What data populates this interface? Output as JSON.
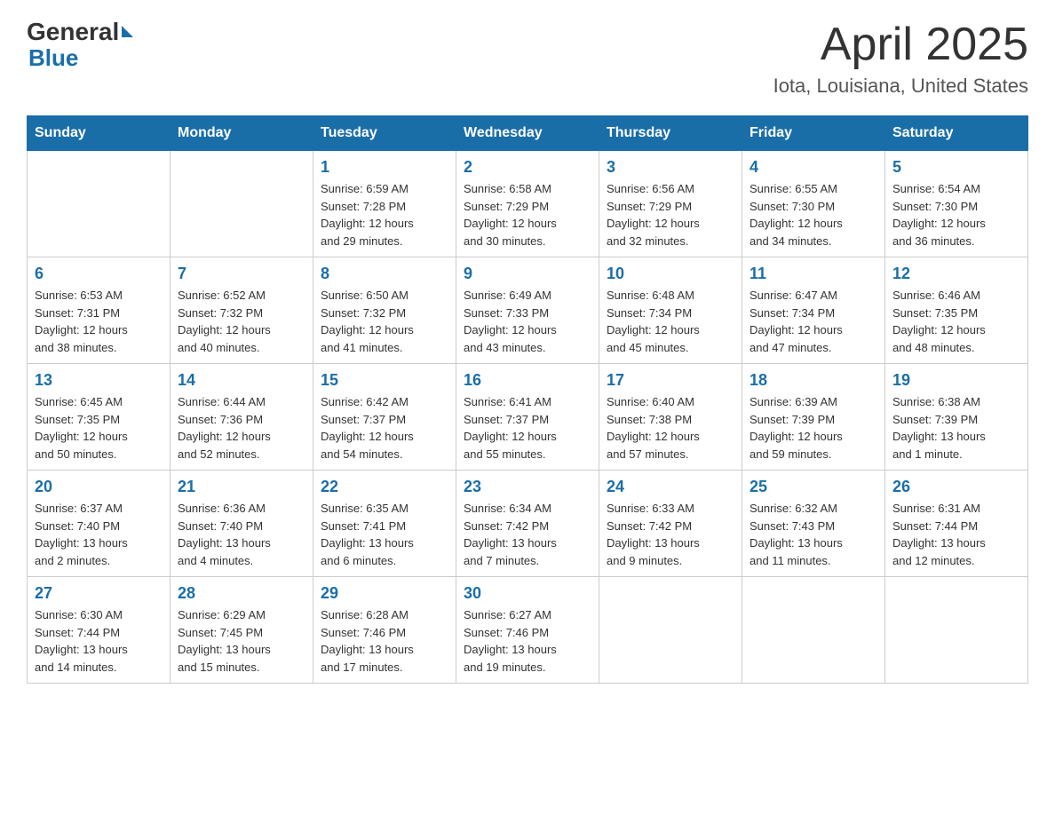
{
  "header": {
    "logo_general": "General",
    "logo_blue": "Blue",
    "month": "April 2025",
    "location": "Iota, Louisiana, United States"
  },
  "days_of_week": [
    "Sunday",
    "Monday",
    "Tuesday",
    "Wednesday",
    "Thursday",
    "Friday",
    "Saturday"
  ],
  "weeks": [
    [
      {
        "day": "",
        "info": ""
      },
      {
        "day": "",
        "info": ""
      },
      {
        "day": "1",
        "info": "Sunrise: 6:59 AM\nSunset: 7:28 PM\nDaylight: 12 hours\nand 29 minutes."
      },
      {
        "day": "2",
        "info": "Sunrise: 6:58 AM\nSunset: 7:29 PM\nDaylight: 12 hours\nand 30 minutes."
      },
      {
        "day": "3",
        "info": "Sunrise: 6:56 AM\nSunset: 7:29 PM\nDaylight: 12 hours\nand 32 minutes."
      },
      {
        "day": "4",
        "info": "Sunrise: 6:55 AM\nSunset: 7:30 PM\nDaylight: 12 hours\nand 34 minutes."
      },
      {
        "day": "5",
        "info": "Sunrise: 6:54 AM\nSunset: 7:30 PM\nDaylight: 12 hours\nand 36 minutes."
      }
    ],
    [
      {
        "day": "6",
        "info": "Sunrise: 6:53 AM\nSunset: 7:31 PM\nDaylight: 12 hours\nand 38 minutes."
      },
      {
        "day": "7",
        "info": "Sunrise: 6:52 AM\nSunset: 7:32 PM\nDaylight: 12 hours\nand 40 minutes."
      },
      {
        "day": "8",
        "info": "Sunrise: 6:50 AM\nSunset: 7:32 PM\nDaylight: 12 hours\nand 41 minutes."
      },
      {
        "day": "9",
        "info": "Sunrise: 6:49 AM\nSunset: 7:33 PM\nDaylight: 12 hours\nand 43 minutes."
      },
      {
        "day": "10",
        "info": "Sunrise: 6:48 AM\nSunset: 7:34 PM\nDaylight: 12 hours\nand 45 minutes."
      },
      {
        "day": "11",
        "info": "Sunrise: 6:47 AM\nSunset: 7:34 PM\nDaylight: 12 hours\nand 47 minutes."
      },
      {
        "day": "12",
        "info": "Sunrise: 6:46 AM\nSunset: 7:35 PM\nDaylight: 12 hours\nand 48 minutes."
      }
    ],
    [
      {
        "day": "13",
        "info": "Sunrise: 6:45 AM\nSunset: 7:35 PM\nDaylight: 12 hours\nand 50 minutes."
      },
      {
        "day": "14",
        "info": "Sunrise: 6:44 AM\nSunset: 7:36 PM\nDaylight: 12 hours\nand 52 minutes."
      },
      {
        "day": "15",
        "info": "Sunrise: 6:42 AM\nSunset: 7:37 PM\nDaylight: 12 hours\nand 54 minutes."
      },
      {
        "day": "16",
        "info": "Sunrise: 6:41 AM\nSunset: 7:37 PM\nDaylight: 12 hours\nand 55 minutes."
      },
      {
        "day": "17",
        "info": "Sunrise: 6:40 AM\nSunset: 7:38 PM\nDaylight: 12 hours\nand 57 minutes."
      },
      {
        "day": "18",
        "info": "Sunrise: 6:39 AM\nSunset: 7:39 PM\nDaylight: 12 hours\nand 59 minutes."
      },
      {
        "day": "19",
        "info": "Sunrise: 6:38 AM\nSunset: 7:39 PM\nDaylight: 13 hours\nand 1 minute."
      }
    ],
    [
      {
        "day": "20",
        "info": "Sunrise: 6:37 AM\nSunset: 7:40 PM\nDaylight: 13 hours\nand 2 minutes."
      },
      {
        "day": "21",
        "info": "Sunrise: 6:36 AM\nSunset: 7:40 PM\nDaylight: 13 hours\nand 4 minutes."
      },
      {
        "day": "22",
        "info": "Sunrise: 6:35 AM\nSunset: 7:41 PM\nDaylight: 13 hours\nand 6 minutes."
      },
      {
        "day": "23",
        "info": "Sunrise: 6:34 AM\nSunset: 7:42 PM\nDaylight: 13 hours\nand 7 minutes."
      },
      {
        "day": "24",
        "info": "Sunrise: 6:33 AM\nSunset: 7:42 PM\nDaylight: 13 hours\nand 9 minutes."
      },
      {
        "day": "25",
        "info": "Sunrise: 6:32 AM\nSunset: 7:43 PM\nDaylight: 13 hours\nand 11 minutes."
      },
      {
        "day": "26",
        "info": "Sunrise: 6:31 AM\nSunset: 7:44 PM\nDaylight: 13 hours\nand 12 minutes."
      }
    ],
    [
      {
        "day": "27",
        "info": "Sunrise: 6:30 AM\nSunset: 7:44 PM\nDaylight: 13 hours\nand 14 minutes."
      },
      {
        "day": "28",
        "info": "Sunrise: 6:29 AM\nSunset: 7:45 PM\nDaylight: 13 hours\nand 15 minutes."
      },
      {
        "day": "29",
        "info": "Sunrise: 6:28 AM\nSunset: 7:46 PM\nDaylight: 13 hours\nand 17 minutes."
      },
      {
        "day": "30",
        "info": "Sunrise: 6:27 AM\nSunset: 7:46 PM\nDaylight: 13 hours\nand 19 minutes."
      },
      {
        "day": "",
        "info": ""
      },
      {
        "day": "",
        "info": ""
      },
      {
        "day": "",
        "info": ""
      }
    ]
  ]
}
